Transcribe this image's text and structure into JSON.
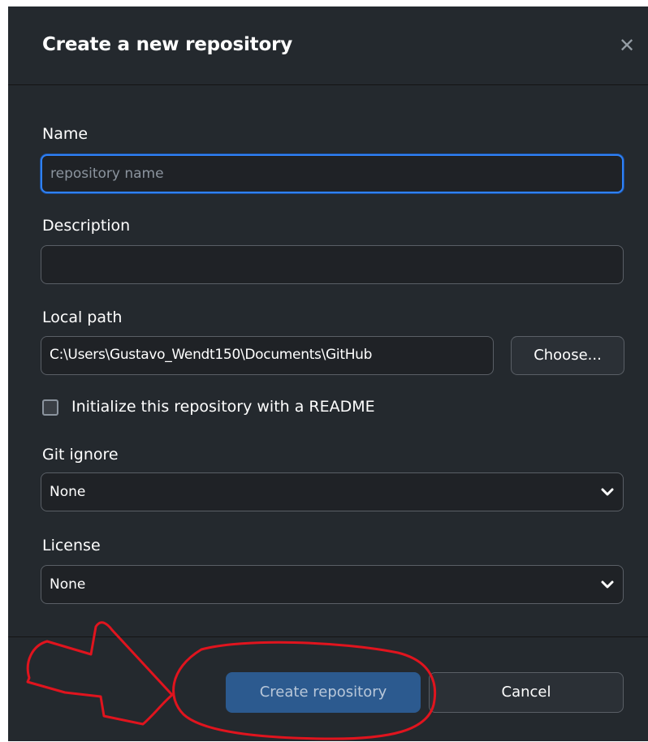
{
  "dialog": {
    "title": "Create a new repository",
    "close_icon": "close-icon"
  },
  "form": {
    "name_label": "Name",
    "name_placeholder": "repository name",
    "name_value": "",
    "description_label": "Description",
    "description_value": "",
    "local_path_label": "Local path",
    "local_path_value": "C:\\Users\\Gustavo_Wendt150\\Documents\\GitHub",
    "choose_label": "Choose...",
    "readme_label": "Initialize this repository with a README",
    "readme_checked": false,
    "gitignore_label": "Git ignore",
    "gitignore_value": "None",
    "license_label": "License",
    "license_value": "None"
  },
  "footer": {
    "create_label": "Create repository",
    "cancel_label": "Cancel"
  },
  "colors": {
    "dialog_bg": "#24292e",
    "field_bg": "#1f2226",
    "focus_border": "#2f81f7",
    "primary_button": "#2c5a8f",
    "annotation_red": "#e0141e"
  }
}
